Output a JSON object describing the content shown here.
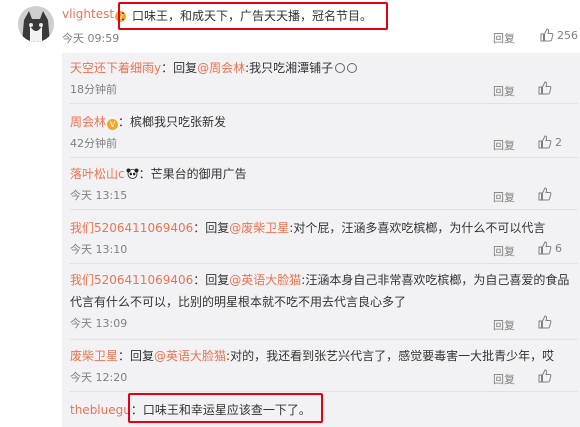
{
  "top_comment": {
    "username": "vlightest",
    "text": "：口味王，和成天下，广告天天播，冠名节目。",
    "time": "今天 09:59",
    "reply_label": "回复",
    "like_count": "256"
  },
  "replies": [
    {
      "user": "天空还下着细雨y",
      "prefix": "：回复",
      "mention": "@周会林",
      "text": ":我只吃湘潭铺子",
      "time": "18分钟前",
      "reply_label": "回复",
      "like_count": ""
    },
    {
      "user": "周会林",
      "prefix": "",
      "mention": "",
      "text": "：槟榔我只吃张新发",
      "time": "42分钟前",
      "reply_label": "回复",
      "like_count": "2"
    },
    {
      "user": "落叶松山c",
      "prefix": "",
      "mention": "",
      "text": "：芒果台的御用广告",
      "time": "今天 13:15",
      "reply_label": "回复",
      "like_count": ""
    },
    {
      "user": "我们5206411069406",
      "prefix": "：回复",
      "mention": "@废柴卫星",
      "text": ":对个屁，汪涵多喜欢吃槟榔，为什么不可以代言",
      "time": "今天 13:10",
      "reply_label": "回复",
      "like_count": "6"
    },
    {
      "user": "我们5206411069406",
      "prefix": "：回复",
      "mention": "@英语大脸猫",
      "text": ":汪涵本身自己非常喜欢吃槟榔，为自己喜爱的食品",
      "text2": "代言有什么不可以，比别的明星根本就不吃不用去代言良心多了",
      "time": "今天 13:09",
      "reply_label": "回复",
      "like_count": ""
    },
    {
      "user": "废柴卫星",
      "prefix": "：回复",
      "mention": "@英语大脸猫",
      "text": ":对的，我还看到张艺兴代言了，感觉要毒害一大批青少年，哎",
      "time": "今天 12:20",
      "reply_label": "回复",
      "like_count": ""
    },
    {
      "user": "thebluegu",
      "prefix": "",
      "mention": "",
      "text": "：口味王和幸运星应该查一下了。",
      "time": "",
      "reply_label": "",
      "like_count": ""
    }
  ],
  "colors": {
    "username": "#eb7350",
    "highlight_box": "#e60012",
    "panel_bg": "#f2f2f5"
  }
}
